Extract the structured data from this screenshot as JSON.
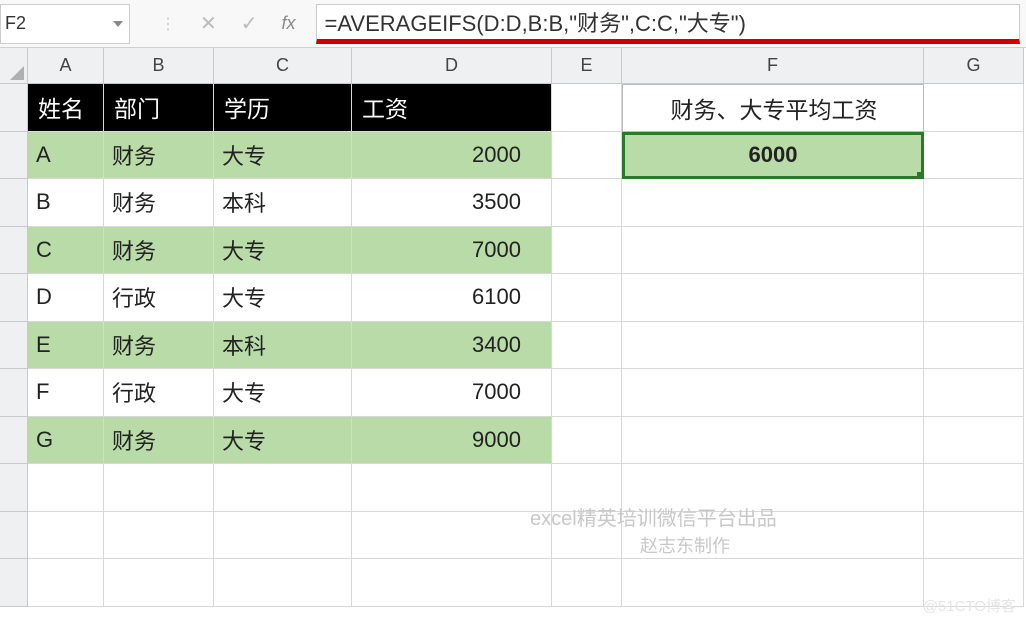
{
  "formula_bar": {
    "name_box": "F2",
    "formula": "=AVERAGEIFS(D:D,B:B,\"财务\",C:C,\"大专\")"
  },
  "columns": [
    "A",
    "B",
    "C",
    "D",
    "E",
    "F",
    "G"
  ],
  "headers": {
    "c1": "姓名",
    "c2": "部门",
    "c3": "学历",
    "c4": "工资"
  },
  "side_header": "财务、大专平均工资",
  "result_value": "6000",
  "rows": [
    {
      "name": "A",
      "dept": "财务",
      "edu": "大专",
      "salary": "2000",
      "alt": true
    },
    {
      "name": "B",
      "dept": "财务",
      "edu": "本科",
      "salary": "3500",
      "alt": false
    },
    {
      "name": "C",
      "dept": "财务",
      "edu": "大专",
      "salary": "7000",
      "alt": true
    },
    {
      "name": "D",
      "dept": "行政",
      "edu": "大专",
      "salary": "6100",
      "alt": false
    },
    {
      "name": "E",
      "dept": "财务",
      "edu": "本科",
      "salary": "3400",
      "alt": true
    },
    {
      "name": "F",
      "dept": "行政",
      "edu": "大专",
      "salary": "7000",
      "alt": false
    },
    {
      "name": "G",
      "dept": "财务",
      "edu": "大专",
      "salary": "9000",
      "alt": true
    }
  ],
  "watermarks": {
    "w1": "excel精英培训微信平台出品",
    "w2": "赵志东制作",
    "w3": "@51CTO博客"
  }
}
